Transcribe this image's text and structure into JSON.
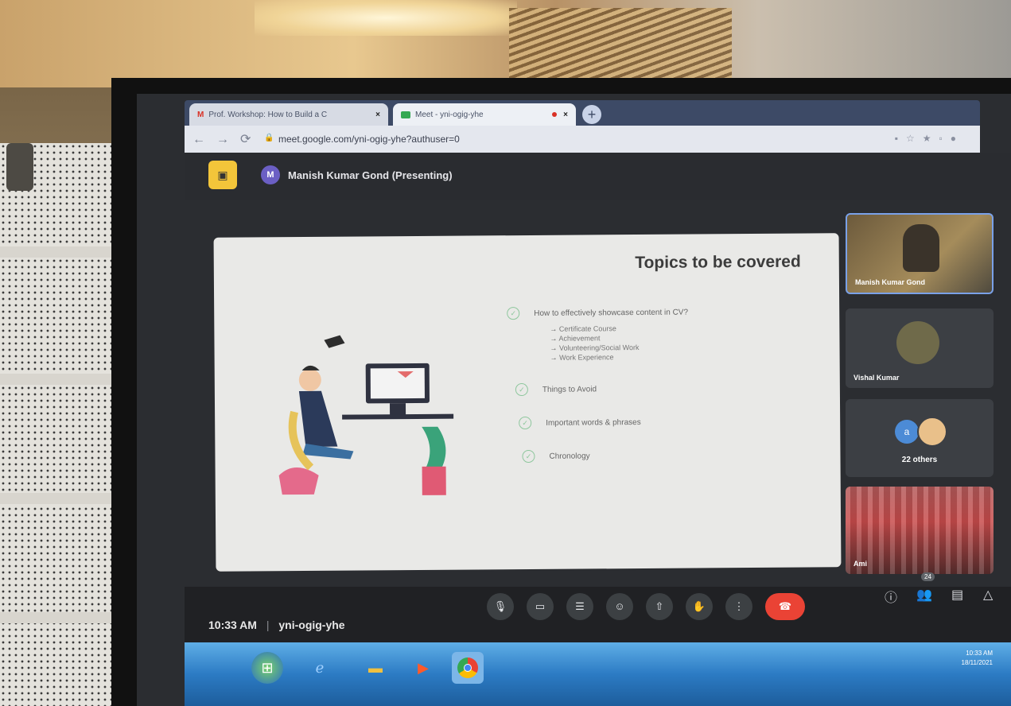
{
  "browser": {
    "tabs": [
      {
        "label": "Prof. Workshop: How to Build a C",
        "close": "×"
      },
      {
        "label": "Meet - yni-ogig-yhe",
        "close": "×"
      }
    ],
    "new_tab": "+",
    "url": "meet.google.com/yni-ogig-yhe?authuser=0"
  },
  "meet": {
    "presenter_initial": "M",
    "presenter_label": "Manish Kumar Gond (Presenting)",
    "slide": {
      "title": "Topics to be covered",
      "topics": [
        {
          "label": "How to effectively showcase content in CV?",
          "subitems": [
            "Certificate Course",
            "Achievement",
            "Volunteering/Social Work",
            "Work Experience"
          ]
        },
        {
          "label": "Things to Avoid",
          "subitems": []
        },
        {
          "label": "Important words & phrases",
          "subitems": []
        },
        {
          "label": "Chronology",
          "subitems": []
        }
      ]
    },
    "participants": {
      "tile1_name": "Manish Kumar Gond",
      "tile2_name": "Vishal Kumar",
      "tile3_initial": "a",
      "tile3_label": "22 others",
      "tile4_name": "Ami"
    },
    "clock": "10:33 AM",
    "separator": "|",
    "meeting_code": "yni-ogig-yhe",
    "people_count": "24"
  },
  "taskbar": {
    "time": "10:33 AM",
    "date": "18/11/2021"
  },
  "colors": {
    "end_call": "#ea4335",
    "accent_present": "#f3c53a",
    "avatar": "#6b5fc4"
  }
}
